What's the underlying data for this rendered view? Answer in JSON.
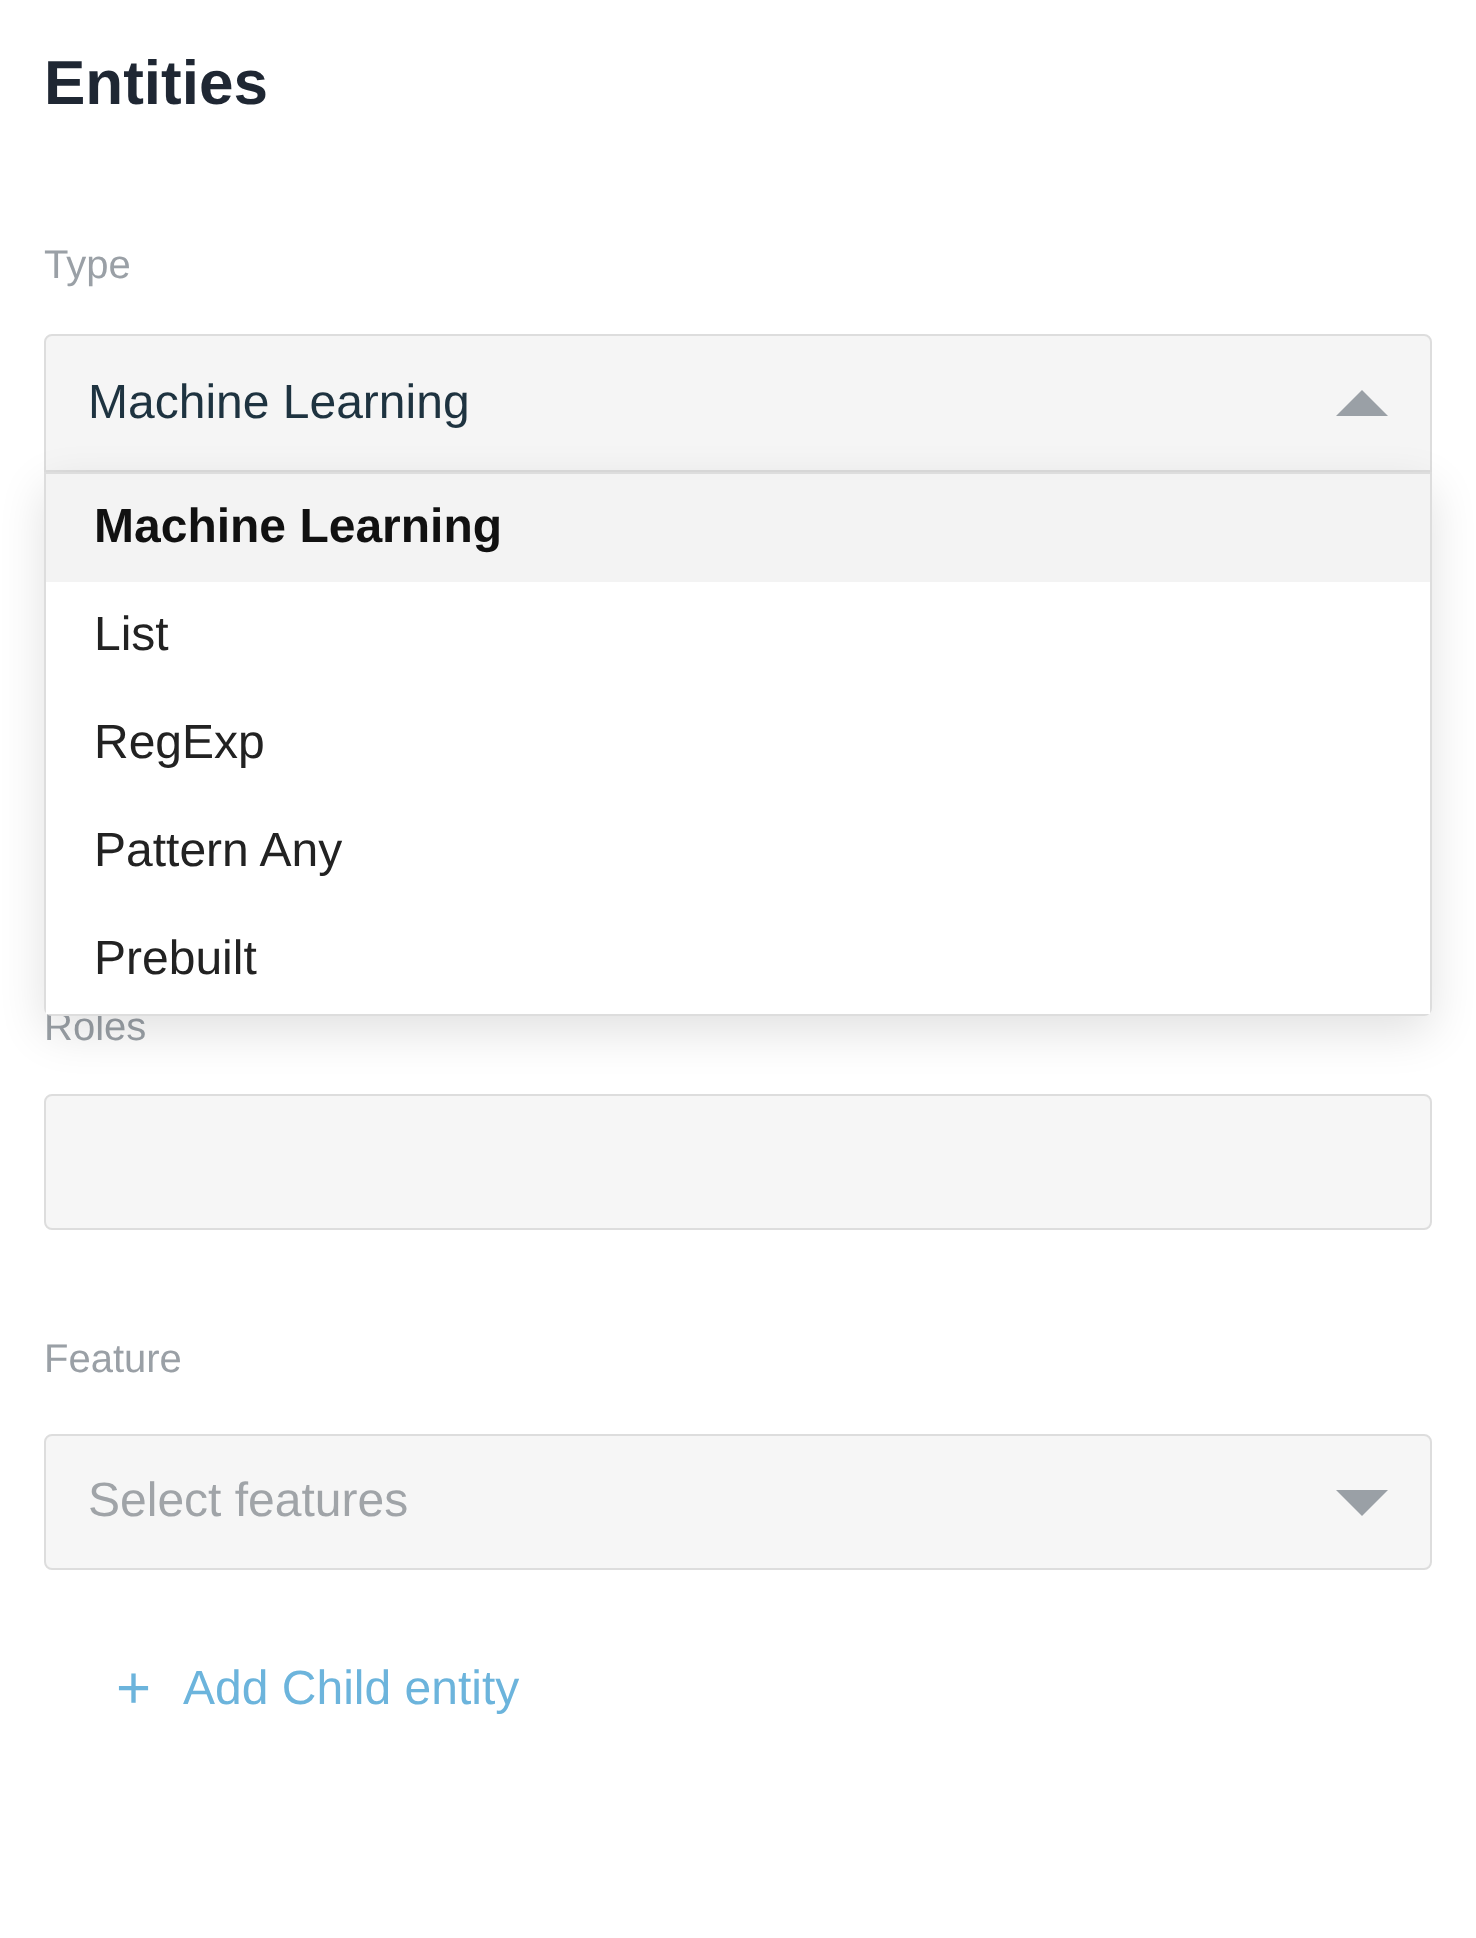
{
  "title": "Entities",
  "type_field": {
    "label": "Type",
    "value": "Machine Learning",
    "expanded": true,
    "options": [
      {
        "label": "Machine Learning",
        "selected": true
      },
      {
        "label": "List",
        "selected": false
      },
      {
        "label": "RegExp",
        "selected": false
      },
      {
        "label": "Pattern Any",
        "selected": false
      },
      {
        "label": "Prebuilt",
        "selected": false
      }
    ]
  },
  "roles_field": {
    "label": "Roles"
  },
  "feature_field": {
    "label": "Feature",
    "placeholder": "Select features",
    "expanded": false
  },
  "add_button": {
    "icon": "+",
    "label": "Add Child entity"
  }
}
